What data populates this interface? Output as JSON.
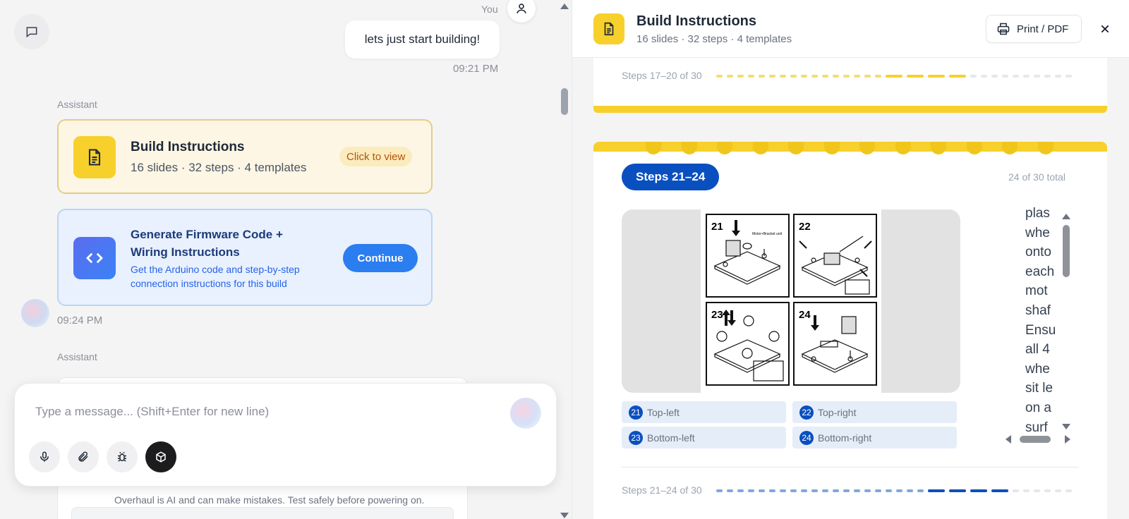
{
  "chat": {
    "you_label": "You",
    "user_message": "lets just start building!",
    "user_time": "09:21 PM",
    "assistant_label_1": "Assistant",
    "build_card": {
      "title": "Build Instructions",
      "subtitle": "16 slides · 32 steps · 4 templates",
      "cta": "Click to view"
    },
    "firmware_card": {
      "title": "Generate Firmware Code + Wiring Instructions",
      "description": "Get the Arduino code and step-by-step connection instructions for this build",
      "button": "Continue"
    },
    "assistant_time": "09:24 PM",
    "assistant_label_2": "Assistant",
    "composer_placeholder": "Type a message... (Shift+Enter for new line)",
    "disclaimer": "Overhaul is AI and can make mistakes. Test safely before powering on.",
    "tools": [
      "microphone-icon",
      "paperclip-icon",
      "bug-icon",
      "cube-icon"
    ]
  },
  "viewer": {
    "title": "Build Instructions",
    "subtitle": "16 slides · 32 steps · 4 templates",
    "print_label": "Print / PDF",
    "prev_slide": {
      "progress_label": "Steps 17–20 of 30",
      "steps_shown": [
        17,
        18,
        19,
        20
      ],
      "total_steps": 30
    },
    "slide": {
      "badge": "Steps 21–24",
      "total_label": "24 of 30 total",
      "panel_numbers": [
        "21",
        "22",
        "23",
        "24"
      ],
      "panel_note": "Motor+Bracket unit",
      "chips": [
        {
          "num": "21",
          "label": "Top-left"
        },
        {
          "num": "22",
          "label": "Top-right"
        },
        {
          "num": "23",
          "label": "Bottom-left"
        },
        {
          "num": "24",
          "label": "Bottom-right"
        }
      ],
      "text_lines": [
        "plas",
        "whe",
        "onto",
        "each",
        "mot",
        "shaf",
        "Ensu",
        "all 4",
        "whe",
        "sit le",
        "on a",
        "surf"
      ],
      "progress_label": "Steps 21–24 of 30",
      "steps_shown": [
        21,
        22,
        23,
        24
      ],
      "total_steps": 30
    },
    "colors": {
      "accent_yellow": "#f7d02c",
      "accent_blue": "#0a4fbf",
      "light_yellow": "#f6dd6a",
      "light_blue": "#7fa8dc"
    }
  }
}
